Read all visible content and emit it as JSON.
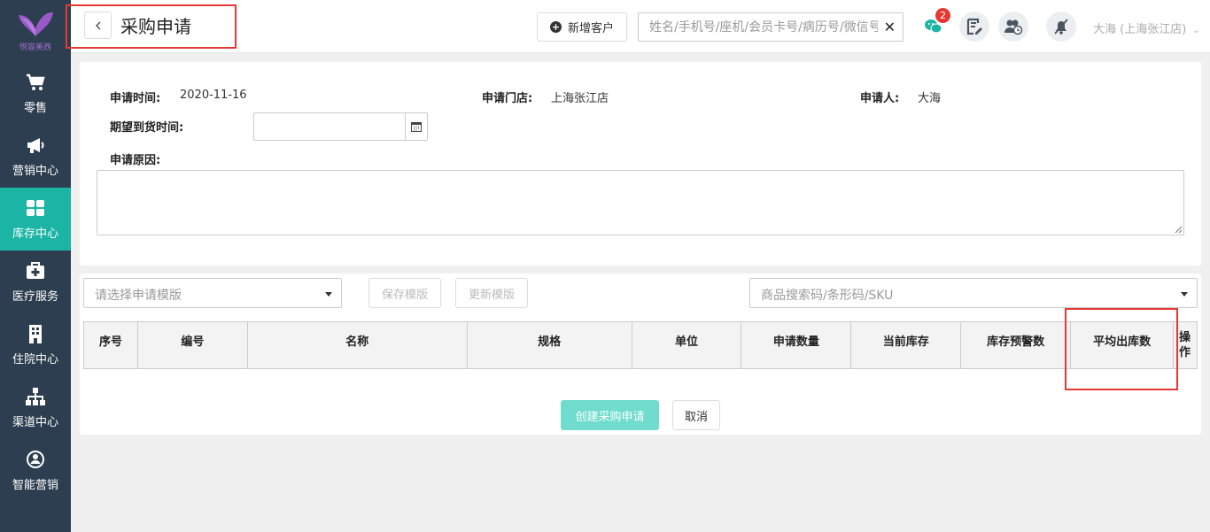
{
  "brand": {
    "name": "悦容美西"
  },
  "sidebar": {
    "items": [
      {
        "label": "零售",
        "icon": "cart-icon"
      },
      {
        "label": "营销中心",
        "icon": "megaphone-icon"
      },
      {
        "label": "库存中心",
        "icon": "grid-icon",
        "active": true
      },
      {
        "label": "医疗服务",
        "icon": "medical-kit-icon"
      },
      {
        "label": "住院中心",
        "icon": "building-icon"
      },
      {
        "label": "渠道中心",
        "icon": "org-chart-icon"
      },
      {
        "label": "智能营销",
        "icon": "smart-marketing-icon"
      }
    ]
  },
  "header": {
    "title": "采购申请",
    "add_customer": "新增客户",
    "search_placeholder": "姓名/手机号/座机/会员卡号/病历号/微信号",
    "wechat_badge": "2",
    "user": "大海 (上海张江店)"
  },
  "form": {
    "apply_time_label": "申请时间:",
    "apply_time_value": "2020-11-16",
    "store_label": "申请门店:",
    "store_value": "上海张江店",
    "applicant_label": "申请人:",
    "applicant_value": "大海",
    "expected_label": "期望到货时间:",
    "reason_label": "申请原因:"
  },
  "toolbar": {
    "template_placeholder": "请选择申请模版",
    "save_template": "保存模版",
    "update_template": "更新模版",
    "sku_placeholder": "商品搜索码/条形码/SKU"
  },
  "table": {
    "columns": [
      "序号",
      "编号",
      "名称",
      "规格",
      "单位",
      "申请数量",
      "当前库存",
      "库存预警数",
      "平均出库数",
      "操作"
    ]
  },
  "actions": {
    "create": "创建采购申请",
    "cancel": "取消"
  },
  "colors": {
    "sidebar_bg": "#2c3e4f",
    "accent": "#1cb5a5",
    "highlight_box": "#e53935"
  }
}
